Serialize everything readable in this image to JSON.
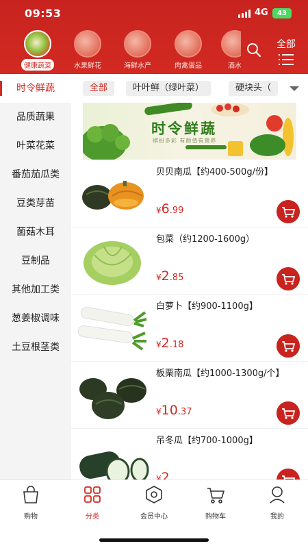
{
  "status": {
    "time": "09:53",
    "network": "4G",
    "battery": "43"
  },
  "top_categories": [
    {
      "label": "健康蔬菜",
      "active": true
    },
    {
      "label": "水果鲜花",
      "active": false
    },
    {
      "label": "海鲜水产",
      "active": false
    },
    {
      "label": "肉禽蛋品",
      "active": false
    },
    {
      "label": "酒水",
      "active": false
    }
  ],
  "header": {
    "all_label": "全部"
  },
  "sidebar": {
    "items": [
      "时令鲜蔬",
      "品质蔬果",
      "叶菜花菜",
      "番茄茄瓜类",
      "豆类芽苗",
      "菌菇木耳",
      "豆制品",
      "其他加工类",
      "葱姜椒调味",
      "土豆根茎类"
    ],
    "active_index": 0
  },
  "filters": [
    "全部",
    "叶叶鲜（绿叶菜）",
    "硬块头（"
  ],
  "banner": {
    "title": "时令鲜蔬",
    "subtitle": "缤纷多彩  有颜值有营养"
  },
  "products": [
    {
      "name": "贝贝南瓜【约400-500g/份】",
      "currency": "¥",
      "price_int": "6",
      "price_dec": ".99"
    },
    {
      "name": "包菜（约1200-1600g）",
      "currency": "¥",
      "price_int": "2",
      "price_dec": ".85"
    },
    {
      "name": "白萝卜【约900-1100g】",
      "currency": "¥",
      "price_int": "2",
      "price_dec": ".18"
    },
    {
      "name": "板栗南瓜【约1000-1300g/个】",
      "currency": "¥",
      "price_int": "10",
      "price_dec": ".37"
    },
    {
      "name": "吊冬瓜【约700-1000g】",
      "currency": "¥",
      "price_int": "2",
      "price_dec": ""
    }
  ],
  "tabbar": [
    {
      "label": "购物",
      "icon": "shopping-bag-icon",
      "active": false
    },
    {
      "label": "分类",
      "icon": "grid-icon",
      "active": true
    },
    {
      "label": "会员中心",
      "icon": "hexagon-icon",
      "active": false
    },
    {
      "label": "购物车",
      "icon": "cart-icon",
      "active": false
    },
    {
      "label": "我的",
      "icon": "user-icon",
      "active": false
    }
  ],
  "colors": {
    "brand": "#d22a22",
    "cart_button": "#c8231f"
  }
}
